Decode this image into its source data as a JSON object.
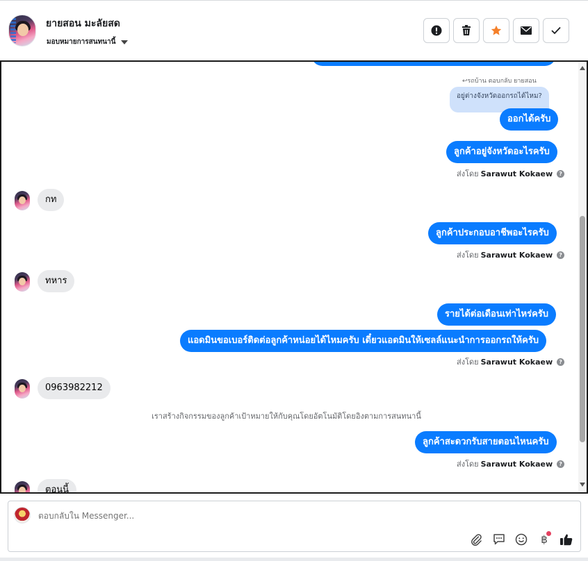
{
  "header": {
    "name": "ยายสอน มะลัยสด",
    "assign_label": "มอบหมายการสนทนานี้",
    "buttons": [
      "report",
      "delete",
      "star",
      "email",
      "done"
    ]
  },
  "conversation": {
    "reply_meta": "↩รถบ้าน ตอบกลับ ยายสอน",
    "quoted_text": "อยู่ต่างจังหวัดออกรถได้ไหม?",
    "sent_by_prefix": "ส่งโดย",
    "sent_by_name": "Sarawut Kokaew",
    "messages": [
      {
        "dir": "out",
        "text": "ออกได้ครับ"
      },
      {
        "dir": "out",
        "text": "ลูกค้าอยู่จังหวัดอะไรครับ"
      },
      {
        "dir": "in",
        "text": "กท"
      },
      {
        "dir": "out",
        "text": "ลูกค้าประกอบอาชีพอะไรครับ"
      },
      {
        "dir": "in",
        "text": "ทหาร"
      },
      {
        "dir": "out",
        "text": "รายได้ต่อเดือนเท่าไหร่ครับ"
      },
      {
        "dir": "out",
        "text": "แอดมินขอเบอร์ติดต่อลูกค้าหน่อยได้ไหมครับ เดี๋ยวแอดมินให้เซลล์แนะนำการออกรถให้ครับ"
      },
      {
        "dir": "in",
        "text": "0963982212"
      },
      {
        "dir": "out",
        "text": "ลูกค้าสะดวกรับสายตอนไหนครับ"
      },
      {
        "dir": "in",
        "text": "ตอนนี้"
      }
    ],
    "system_note": "เราสร้างกิจกรรมของลูกค้าเป้าหมายให้กับคุณโดยอัตโนมัติโดยอิงตามการสนทนานี้"
  },
  "composer": {
    "placeholder": "ตอบกลับใน Messenger...",
    "tools": [
      "paperclip-icon",
      "chat-bubble-icon",
      "emoji-icon",
      "baht-icon",
      "like-icon"
    ],
    "baht_symbol": "฿"
  },
  "colors": {
    "outgoing": "#0a7cff",
    "incoming": "#e9eaec",
    "quote": "#cfe1fb",
    "star": "#f5802a"
  }
}
